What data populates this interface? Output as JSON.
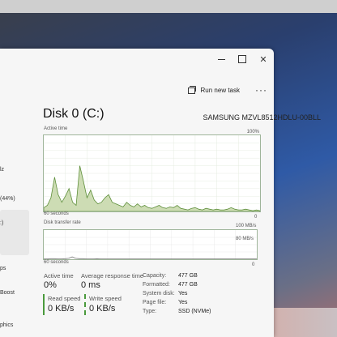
{
  "window": {
    "run_new_task": "Run new task",
    "more": "···"
  },
  "sidebar": {
    "items": [
      {
        "label": "lz"
      },
      {
        "label": "(44%)"
      },
      {
        "label": ":)"
      },
      {
        "label": "ps"
      },
      {
        "label": "Boost"
      },
      {
        "label": "phics"
      }
    ]
  },
  "disk": {
    "title": "Disk 0 (C:)",
    "model": "SAMSUNG MZVL8512HDLU-00BLL",
    "active_time_label": "Active time",
    "active_time_max": "100%",
    "active_time_xlabel": "60 seconds",
    "active_time_min": "0",
    "transfer_label": "Disk transfer rate",
    "transfer_max": "100 MB/s",
    "transfer_mid": "80 MB/s",
    "transfer_xlabel": "60 seconds",
    "transfer_min": "0"
  },
  "stats": {
    "active_time_label": "Active time",
    "active_time_value": "0%",
    "avg_response_label": "Average response time",
    "avg_response_value": "0 ms",
    "read_speed_label": "Read speed",
    "read_speed_value": "0 KB/s",
    "write_speed_label": "Write speed",
    "write_speed_value": "0 KB/s"
  },
  "details": [
    {
      "label": "Capacity:",
      "value": "477 GB"
    },
    {
      "label": "Formatted:",
      "value": "477 GB"
    },
    {
      "label": "System disk:",
      "value": "Yes"
    },
    {
      "label": "Page file:",
      "value": "Yes"
    },
    {
      "label": "Type:",
      "value": "SSD (NVMe)"
    }
  ],
  "chart_data": [
    {
      "type": "area",
      "title": "Active time",
      "xlabel": "60 seconds",
      "ylim": [
        0,
        100
      ],
      "x": [
        0,
        1,
        2,
        3,
        4,
        5,
        6,
        7,
        8,
        9,
        10,
        11,
        12,
        13,
        14,
        15,
        16,
        17,
        18,
        19,
        20,
        21,
        22,
        23,
        24,
        25,
        26,
        27,
        28,
        29,
        30,
        31,
        32,
        33,
        34,
        35,
        36,
        37,
        38,
        39,
        40,
        41,
        42,
        43,
        44,
        45,
        46,
        47,
        48,
        49,
        50,
        51,
        52,
        53,
        54,
        55,
        56,
        57,
        58,
        59,
        60
      ],
      "values": [
        5,
        8,
        18,
        45,
        22,
        12,
        20,
        30,
        12,
        8,
        60,
        40,
        18,
        28,
        15,
        10,
        12,
        18,
        22,
        12,
        10,
        8,
        6,
        12,
        8,
        6,
        10,
        6,
        8,
        5,
        4,
        6,
        8,
        5,
        4,
        6,
        5,
        8,
        4,
        3,
        2,
        4,
        5,
        3,
        2,
        4,
        3,
        2,
        3,
        2,
        2,
        3,
        5,
        3,
        2,
        2,
        3,
        2,
        1,
        2,
        1
      ],
      "fill": "#cddcb4",
      "stroke": "#5e8f3a"
    },
    {
      "type": "line",
      "title": "Disk transfer rate",
      "xlabel": "60 seconds",
      "ylim": [
        0,
        100
      ],
      "x": [
        0,
        1,
        2,
        3,
        4,
        5,
        6,
        7,
        8,
        9,
        10,
        11,
        12,
        13,
        14,
        15,
        16,
        17,
        18,
        19,
        20,
        21,
        22,
        23,
        24,
        25,
        26,
        27,
        28,
        29,
        30,
        31,
        32,
        33,
        34,
        35,
        36,
        37,
        38,
        39,
        40,
        41,
        42,
        43,
        44,
        45,
        46,
        47,
        48,
        49,
        50,
        51,
        52,
        53,
        54,
        55,
        56,
        57,
        58,
        59,
        60
      ],
      "series": [
        {
          "values": [
            1,
            1,
            2,
            2,
            1,
            1,
            2,
            3,
            8,
            3,
            2,
            2,
            1,
            1,
            1,
            2,
            1,
            1,
            1,
            1,
            1,
            1,
            1,
            1,
            1,
            1,
            1,
            1,
            1,
            1,
            1,
            1,
            1,
            1,
            1,
            1,
            1,
            1,
            1,
            1,
            1,
            1,
            1,
            1,
            1,
            1,
            1,
            1,
            1,
            1,
            1,
            1,
            1,
            1,
            1,
            1,
            1,
            1,
            1,
            1,
            1
          ],
          "stroke": "#7a7a7a"
        }
      ]
    }
  ]
}
